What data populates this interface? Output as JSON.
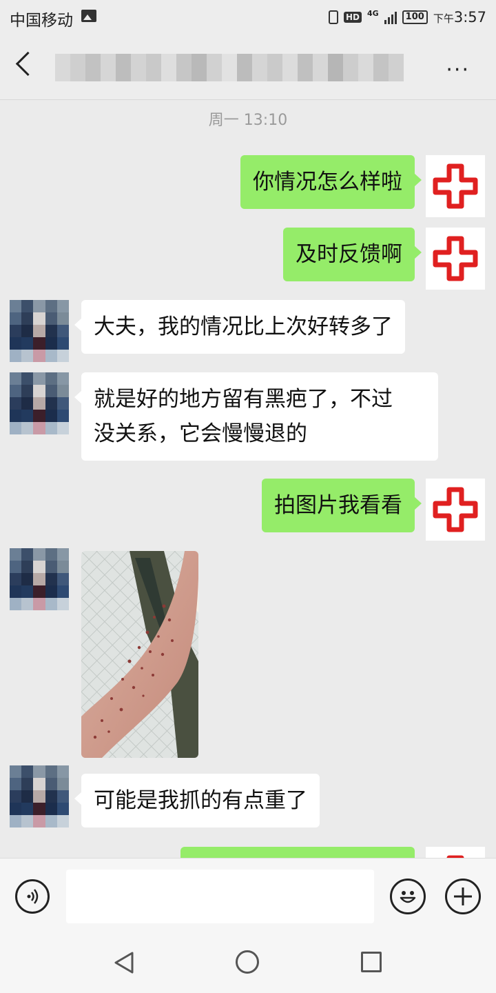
{
  "status_bar": {
    "carrier": "中国移动",
    "network": "4G",
    "hd": "HD",
    "battery": "100",
    "time_prefix": "下午",
    "time": "3:57"
  },
  "header": {
    "title": "",
    "more_label": "···"
  },
  "chat": {
    "timestamp": "周一 13:10",
    "messages": [
      {
        "sender": "me",
        "text": "你情况怎么样啦"
      },
      {
        "sender": "me",
        "text": "及时反馈啊"
      },
      {
        "sender": "them",
        "text": "大夫，我的情况比上次好转多了"
      },
      {
        "sender": "them",
        "line1": "就是好的地方留有黑疤了，不过",
        "line2": "没关系，它会慢慢退的"
      },
      {
        "sender": "me",
        "text": "拍图片我看看"
      },
      {
        "sender": "them",
        "type": "image"
      },
      {
        "sender": "them",
        "text": "可能是我抓的有点重了"
      },
      {
        "sender": "me",
        "text": ""
      }
    ]
  },
  "input_bar": {
    "placeholder": ""
  },
  "icons": {
    "voice": "voice-icon",
    "emoji": "emoji-icon",
    "plus": "plus-icon",
    "back": "back-arrow-icon",
    "more": "more-icon",
    "nav_back": "nav-back-icon",
    "nav_home": "nav-home-icon",
    "nav_recent": "nav-recent-icon"
  },
  "colors": {
    "my_bubble": "#95ec69",
    "their_bubble": "#ffffff",
    "background": "#ebebeb",
    "hospital_cross": "#e02020"
  }
}
